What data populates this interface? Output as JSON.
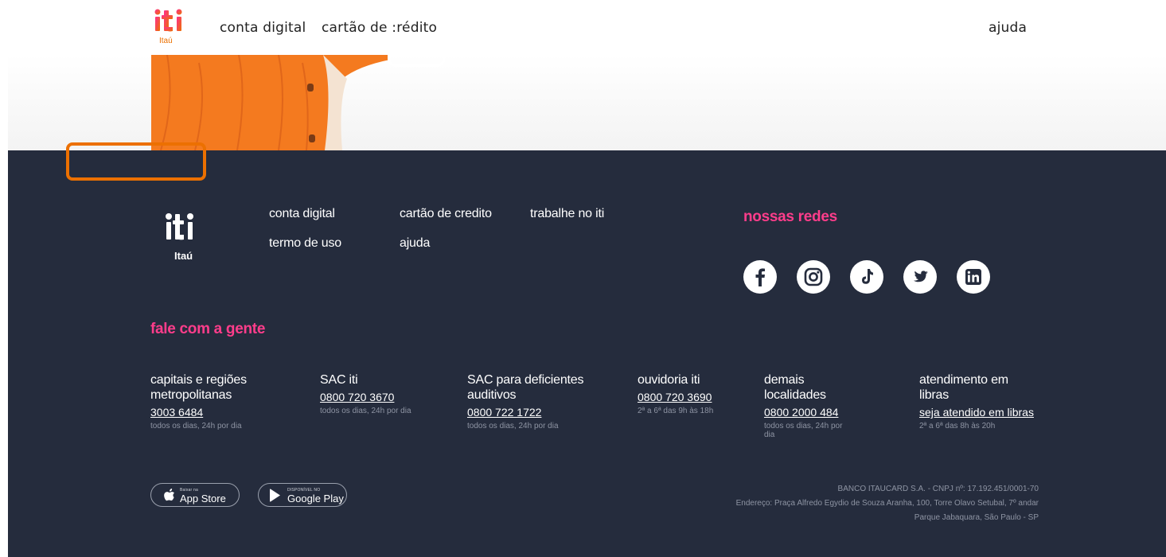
{
  "header": {
    "logo_text": "iti",
    "logo_sub": "Itaú",
    "nav": {
      "conta_digital": "conta digital",
      "cartao_credito": "cartão de :rédito",
      "ajuda": "ajuda"
    }
  },
  "footer": {
    "logo_text": "iti",
    "logo_sub": "Itaú",
    "links": {
      "conta_digital": "conta digital",
      "cartao_credito": "cartão de credito",
      "trabalhe": "trabalhe no iti",
      "termo": "termo de uso",
      "ajuda": "ajuda"
    },
    "redes_heading": "nossas redes",
    "social": [
      "facebook-icon",
      "instagram-icon",
      "tiktok-icon",
      "twitter-icon",
      "linkedin-icon"
    ],
    "fale_heading": "fale com a gente",
    "contacts": [
      {
        "title": "capitais e regiões metropolitanas",
        "phone": "3003 6484",
        "hours": "todos os dias, 24h por dia"
      },
      {
        "title": "SAC iti",
        "phone": "0800 720 3670",
        "hours": "todos os dias, 24h por dia"
      },
      {
        "title": "SAC para deficientes auditivos",
        "phone": "0800 722 1722",
        "hours": "todos os dias, 24h por dia"
      },
      {
        "title": "ouvidoria iti",
        "phone": "0800 720 3690",
        "hours": "2ª a 6ª das 9h às 18h"
      },
      {
        "title": "demais localidades",
        "phone": "0800 2000 484",
        "hours": "todos os dias, 24h por dia"
      },
      {
        "title": "atendimento em libras",
        "phone": "seja atendido em libras",
        "hours": "2ª a 6ª das 8h às 20h"
      }
    ],
    "app_store": {
      "small": "Baixar na",
      "big": "App Store"
    },
    "google_play": {
      "small": "DISPONÍVEL NO",
      "big": "Google Play"
    },
    "legal": {
      "line1": "BANCO ITAUCARD S.A. - CNPJ nº: 17.192.451/0001-70",
      "line2": "Endereço: Praça Alfredo Egydio de Souza Aranha, 100, Torre Olavo Setubal, 7º andar",
      "line3": "Parque Jabaquara, São Paulo - SP"
    }
  },
  "colors": {
    "brand_orange": "#ec7000",
    "accent_pink": "#ff3d8b",
    "footer_bg": "#252c3d"
  }
}
